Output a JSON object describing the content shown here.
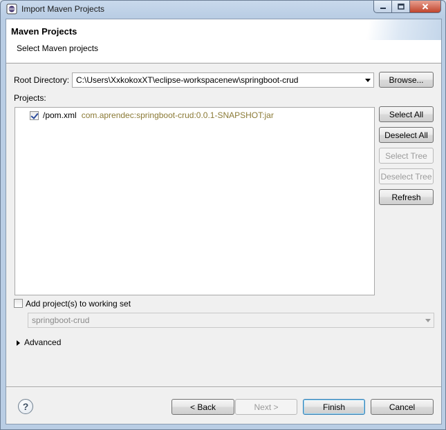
{
  "window": {
    "title": "Import Maven Projects",
    "controls": {
      "minimize": "minimize-icon",
      "maximize": "maximize-icon",
      "close": "close-icon"
    }
  },
  "header": {
    "title": "Maven Projects",
    "subtitle": "Select Maven projects"
  },
  "root_directory": {
    "label": "Root Directory:",
    "value": "C:\\Users\\XxkokoxXT\\eclipse-workspacenew\\springboot-crud",
    "browse_label": "Browse..."
  },
  "projects": {
    "label": "Projects:",
    "items": [
      {
        "name": "/pom.xml",
        "gav": "com.aprendec:springboot-crud:0.0.1-SNAPSHOT:jar",
        "checked": true
      }
    ],
    "buttons": {
      "select_all": "Select All",
      "deselect_all": "Deselect All",
      "select_tree": "Select Tree",
      "deselect_tree": "Deselect Tree",
      "refresh": "Refresh"
    }
  },
  "working_set": {
    "label": "Add project(s) to working set",
    "checked": false,
    "value": "springboot-crud"
  },
  "advanced": {
    "label": "Advanced"
  },
  "footer": {
    "help_glyph": "?",
    "back": "< Back",
    "next": "Next >",
    "finish": "Finish",
    "cancel": "Cancel"
  }
}
